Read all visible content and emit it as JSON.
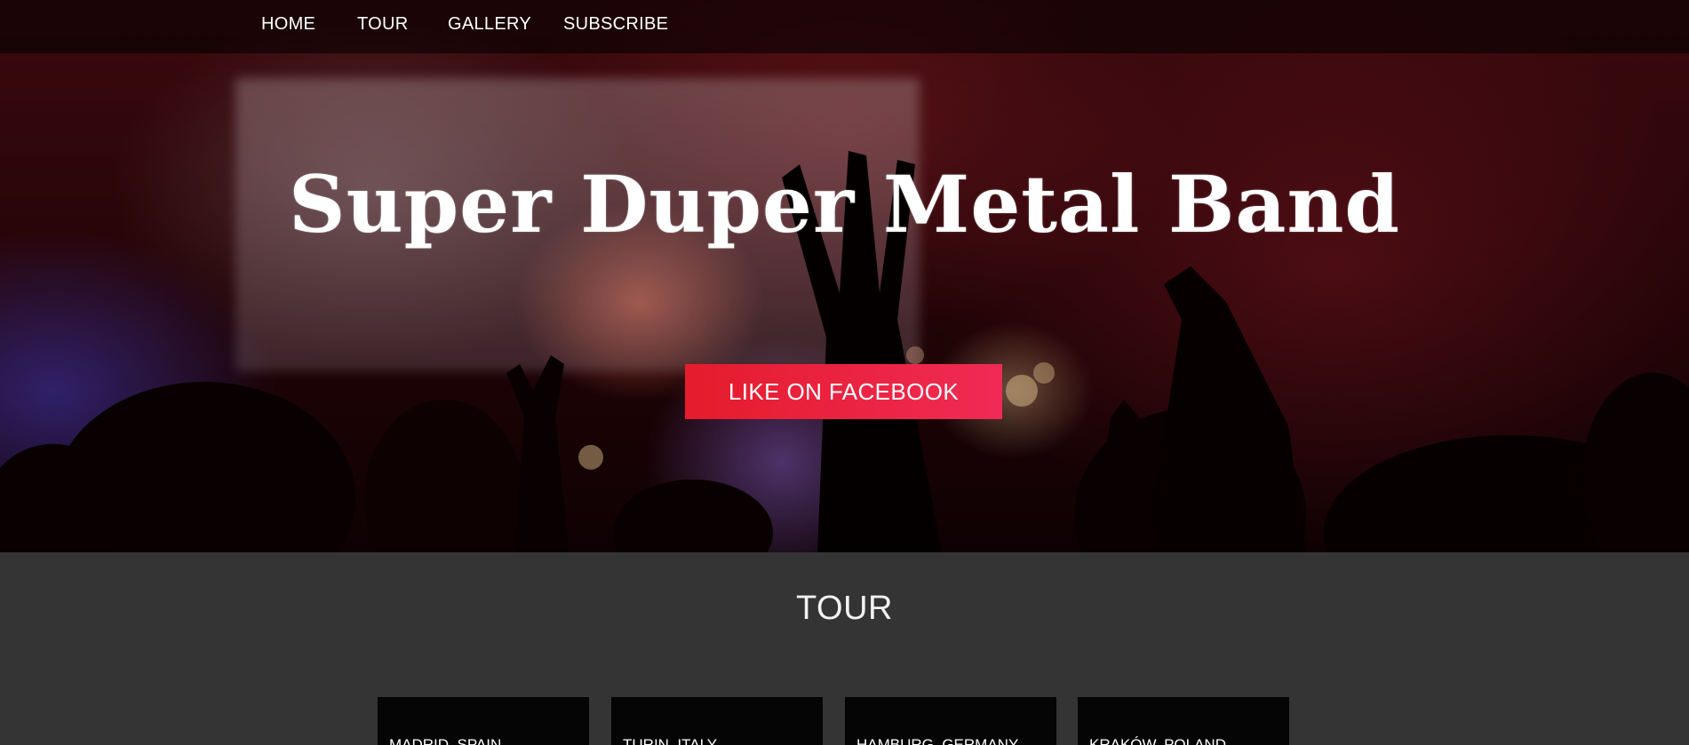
{
  "nav": {
    "items": [
      {
        "label": "HOME"
      },
      {
        "label": "TOUR"
      },
      {
        "label": "GALLERY"
      },
      {
        "label": "SUBSCRIBE"
      }
    ]
  },
  "hero": {
    "title": "Super Duper Metal Band",
    "cta_label": "LIKE ON FACEBOOK"
  },
  "tour": {
    "heading": "TOUR",
    "cards": [
      {
        "city": "MADRID, SPAIN"
      },
      {
        "city": "TURIN, ITALY"
      },
      {
        "city": "HAMBURG, GERMANY"
      },
      {
        "city": "KRAKÓW, POLAND"
      }
    ]
  },
  "colors": {
    "cta_start": "#e51c2c",
    "cta_end": "#f02a55",
    "section_bg": "#343434",
    "navbar_bg": "rgba(0,0,0,0.55)"
  }
}
